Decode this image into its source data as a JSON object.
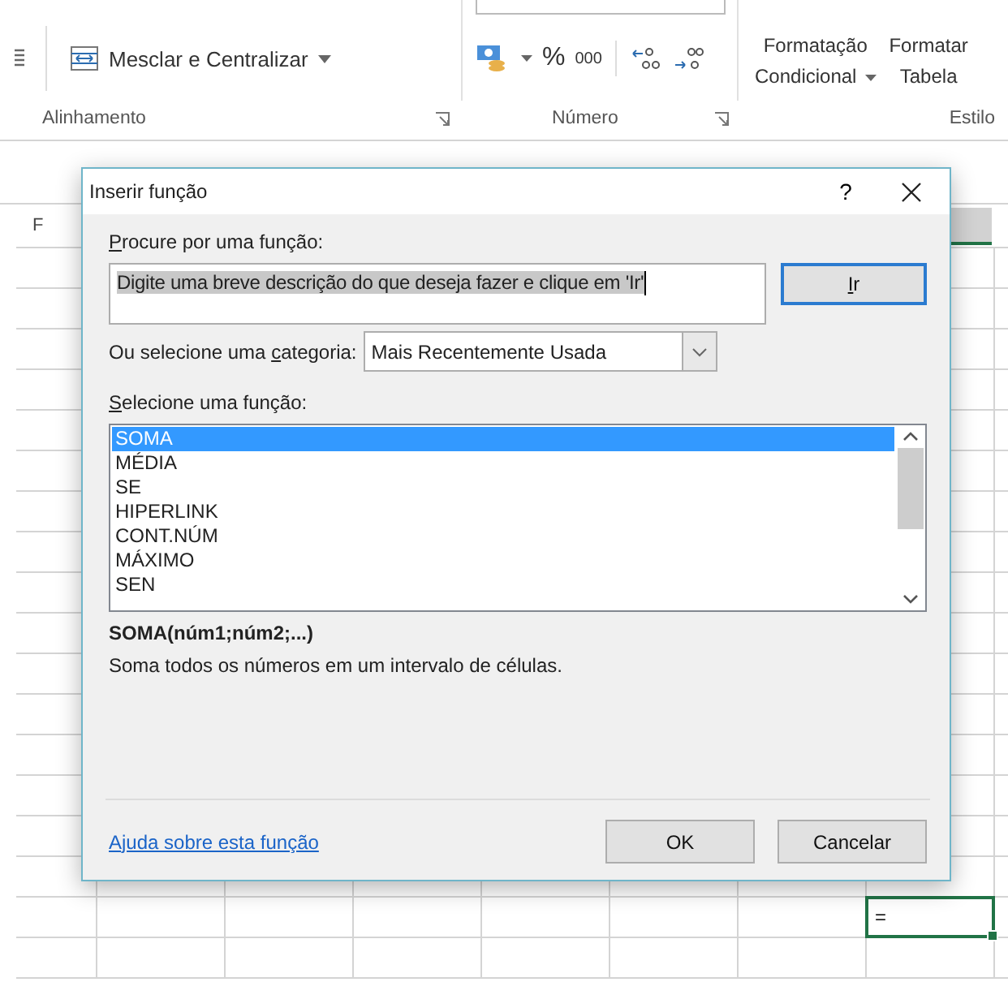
{
  "ribbon": {
    "merge_button": {
      "label": "Mesclar e Centralizar"
    },
    "number_buttons": {
      "percent": "%",
      "thousands": "000"
    },
    "style_buttons": [
      {
        "line1": "Formatação",
        "line2": "Condicional",
        "dropdown": true
      },
      {
        "line1": "Formatar",
        "line2": "Tabela",
        "dropdown": false
      }
    ],
    "groups": [
      {
        "label": "Alinhamento",
        "launcher": true
      },
      {
        "label": "Número",
        "launcher": true
      },
      {
        "label": "Estilo",
        "launcher": false
      }
    ]
  },
  "sheet": {
    "column_header": "F",
    "active_cell": "="
  },
  "dialog": {
    "title": "Inserir função",
    "help": "?",
    "search_label": {
      "key": "P",
      "after": "rocure por uma função:"
    },
    "search_value": "Digite uma breve descrição do que deseja fazer e clique em 'Ir'",
    "go_button": {
      "key": "I",
      "after": "r"
    },
    "category_label": {
      "before": "Ou selecione uma ",
      "key": "c",
      "after": "ategoria:"
    },
    "category_value": "Mais Recentemente Usada",
    "list_label": {
      "key": "S",
      "after": "elecione uma função:"
    },
    "functions": [
      {
        "name": "SOMA",
        "selected": true
      },
      {
        "name": "MÉDIA",
        "selected": false
      },
      {
        "name": "SE",
        "selected": false
      },
      {
        "name": "HIPERLINK",
        "selected": false
      },
      {
        "name": "CONT.NÚM",
        "selected": false
      },
      {
        "name": "MÁXIMO",
        "selected": false
      },
      {
        "name": "SEN",
        "selected": false
      }
    ],
    "signature": "SOMA(núm1;núm2;...)",
    "description": "Soma todos os números em um intervalo de células.",
    "help_link": "Ajuda sobre esta função",
    "buttons": [
      "OK",
      "Cancelar"
    ]
  }
}
